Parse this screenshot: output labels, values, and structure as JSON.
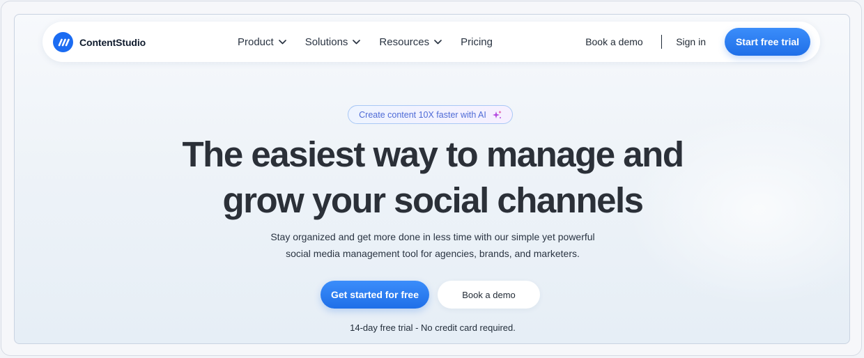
{
  "brand": {
    "name": "ContentStudio",
    "accent": "#1b6cf2"
  },
  "nav": {
    "items": [
      {
        "label": "Product",
        "has_dropdown": true
      },
      {
        "label": "Solutions",
        "has_dropdown": true
      },
      {
        "label": "Resources",
        "has_dropdown": true
      },
      {
        "label": "Pricing",
        "has_dropdown": false
      }
    ],
    "book_demo": "Book a demo",
    "sign_in": "Sign in",
    "cta": "Start free trial"
  },
  "hero": {
    "badge": "Create content 10X faster with AI",
    "badge_icon": "sparkle-icon",
    "title_line1": "The easiest way to manage and",
    "title_line2": "grow your social channels",
    "subtitle_line1": "Stay organized and get more done in less time with our simple yet powerful",
    "subtitle_line2": "social media management tool for agencies, brands, and marketers.",
    "primary_cta": "Get started for free",
    "secondary_cta": "Book a demo",
    "note": "14-day free trial - No credit card required."
  }
}
